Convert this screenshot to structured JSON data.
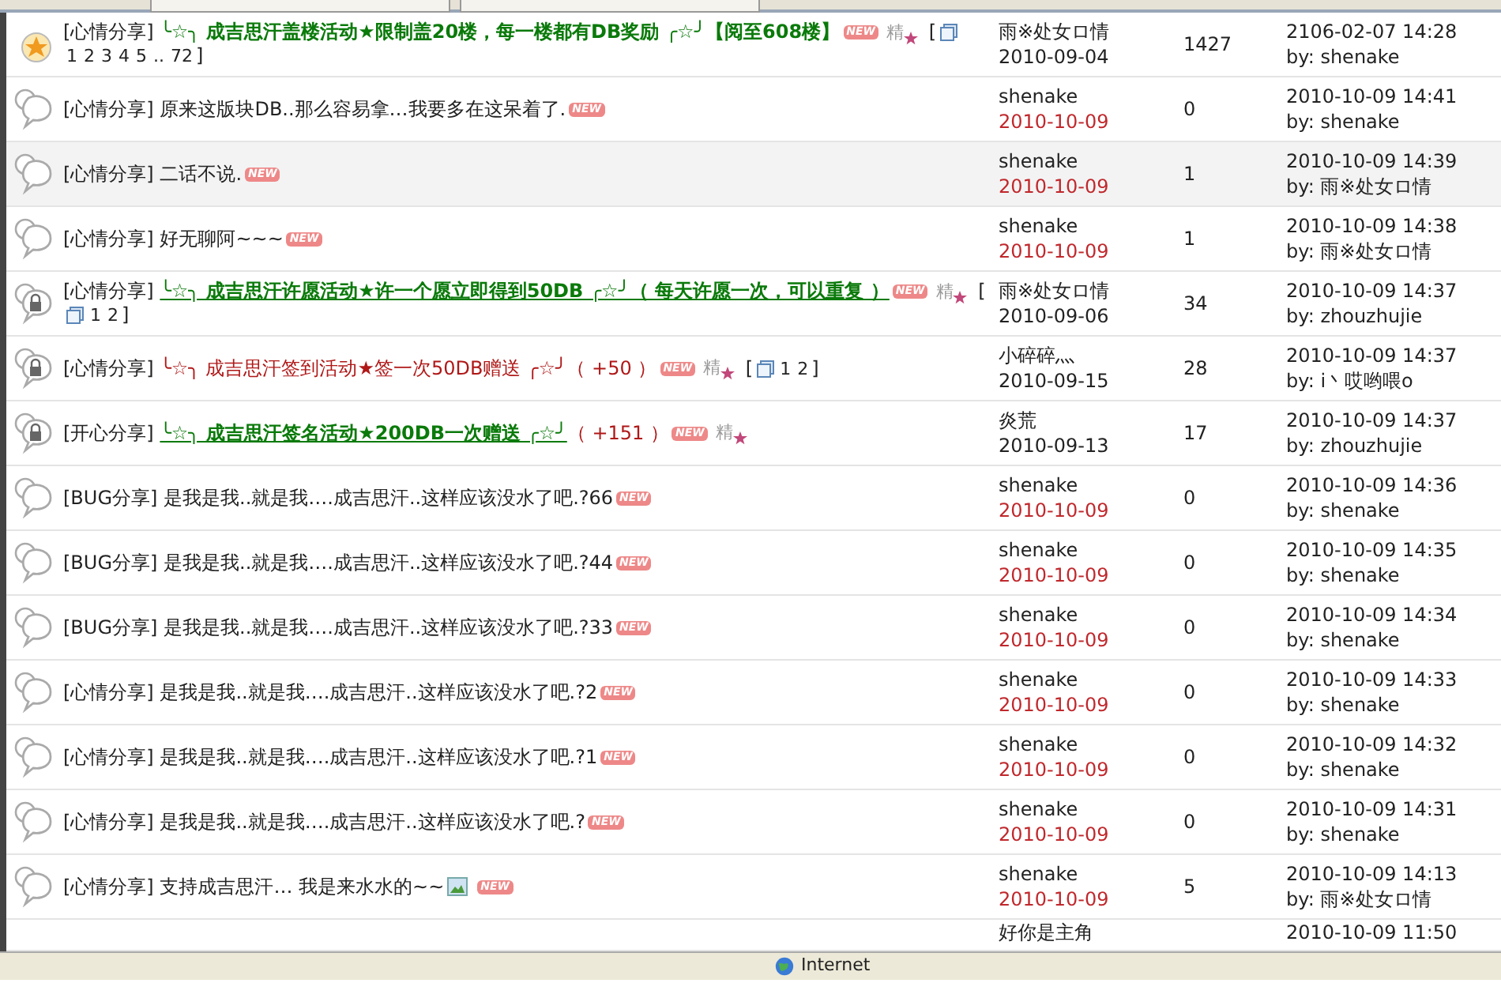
{
  "threads": [
    {
      "kind": "star",
      "selected": false,
      "category": "[心情分享]",
      "segments": [
        {
          "text": "╰☆╮ 成吉思汗盖楼活动★限制盖20楼，每一楼都有DB奖励 ╭☆╯",
          "kind": "green-bold"
        },
        {
          "text": "【阅至608楼】",
          "kind": "green-bold"
        }
      ],
      "badges": [
        {
          "kind": "new",
          "text": "NEW"
        },
        {
          "kind": "digest",
          "text": "精"
        }
      ],
      "pages": {
        "open": "[",
        "numbers": [
          "1",
          "2",
          "3",
          "4",
          "5",
          "..",
          "72"
        ],
        "close": "]"
      },
      "author": "雨※处女ロ情",
      "date": "2010-09-04",
      "recent": false,
      "replies": "1427",
      "last_time": "2106-02-07 14:28",
      "last_by": "by: shenake"
    },
    {
      "kind": "bubble",
      "selected": false,
      "category": "[心情分享]",
      "segments": [
        {
          "text": "原来这版块DB..那么容易拿…我要多在这呆着了.",
          "kind": "plain"
        }
      ],
      "badges": [
        {
          "kind": "new",
          "text": "NEW"
        }
      ],
      "author": "shenake",
      "date": "2010-10-09",
      "recent": true,
      "replies": "0",
      "last_time": "2010-10-09 14:41",
      "last_by": "by: shenake"
    },
    {
      "kind": "bubble",
      "selected": true,
      "category": "[心情分享]",
      "segments": [
        {
          "text": "二话不说.",
          "kind": "plain"
        }
      ],
      "badges": [
        {
          "kind": "new",
          "text": "NEW"
        }
      ],
      "author": "shenake",
      "date": "2010-10-09",
      "recent": true,
      "replies": "1",
      "last_time": "2010-10-09 14:39",
      "last_by": "by: 雨※处女ロ情"
    },
    {
      "kind": "bubble",
      "selected": false,
      "category": "[心情分享]",
      "segments": [
        {
          "text": "好无聊阿~~~",
          "kind": "plain"
        }
      ],
      "badges": [
        {
          "kind": "new",
          "text": "NEW"
        }
      ],
      "author": "shenake",
      "date": "2010-10-09",
      "recent": true,
      "replies": "1",
      "last_time": "2010-10-09 14:38",
      "last_by": "by: 雨※处女ロ情"
    },
    {
      "kind": "lock",
      "selected": false,
      "category": "[心情分享]",
      "segments": [
        {
          "text": "╰☆╮ 成吉思汗许愿活动★许一个愿立即得到50DB ╭☆╯（ 每天许愿一次，可以重复 ）",
          "kind": "green-link"
        }
      ],
      "badges": [
        {
          "kind": "new",
          "text": "NEW"
        },
        {
          "kind": "digest",
          "text": "精"
        }
      ],
      "pages": {
        "open": "[",
        "numbers": [
          "1",
          "2"
        ],
        "close": "]"
      },
      "author": "雨※处女ロ情",
      "date": "2010-09-06",
      "recent": false,
      "replies": "34",
      "last_time": "2010-10-09 14:37",
      "last_by": "by: zhouzhujie"
    },
    {
      "kind": "lock",
      "selected": false,
      "category": "[心情分享]",
      "segments": [
        {
          "text": "╰☆╮ 成吉思汗签到活动★签一次50DB赠送 ╭☆╯（ +50 ）",
          "kind": "red"
        }
      ],
      "badges": [
        {
          "kind": "new",
          "text": "NEW"
        },
        {
          "kind": "digest",
          "text": "精"
        }
      ],
      "pages": {
        "open": "[",
        "numbers": [
          "1",
          "2"
        ],
        "close": "]"
      },
      "author": "小碎碎灬",
      "date": "2010-09-15",
      "recent": false,
      "replies": "28",
      "last_time": "2010-10-09 14:37",
      "last_by": "by: i丶哎哟喂o"
    },
    {
      "kind": "lock",
      "selected": false,
      "category": "[开心分享]",
      "segments": [
        {
          "text": "╰☆╮ 成吉思汗签名活动★200DB一次赠送 ╭☆╯",
          "kind": "green-link"
        },
        {
          "text": "（ +151 ）",
          "kind": "red"
        }
      ],
      "badges": [
        {
          "kind": "new",
          "text": "NEW"
        },
        {
          "kind": "digest",
          "text": "精"
        }
      ],
      "author": "炎荒",
      "date": "2010-09-13",
      "recent": false,
      "replies": "17",
      "last_time": "2010-10-09 14:37",
      "last_by": "by: zhouzhujie"
    },
    {
      "kind": "bubble",
      "selected": false,
      "category": "[BUG分享]",
      "segments": [
        {
          "text": "是我是我..就是我….成吉思汗..这样应该没水了吧.?66",
          "kind": "plain"
        }
      ],
      "badges": [
        {
          "kind": "new",
          "text": "NEW"
        }
      ],
      "author": "shenake",
      "date": "2010-10-09",
      "recent": true,
      "replies": "0",
      "last_time": "2010-10-09 14:36",
      "last_by": "by: shenake"
    },
    {
      "kind": "bubble",
      "selected": false,
      "category": "[BUG分享]",
      "segments": [
        {
          "text": "是我是我..就是我….成吉思汗..这样应该没水了吧.?44",
          "kind": "plain"
        }
      ],
      "badges": [
        {
          "kind": "new",
          "text": "NEW"
        }
      ],
      "author": "shenake",
      "date": "2010-10-09",
      "recent": true,
      "replies": "0",
      "last_time": "2010-10-09 14:35",
      "last_by": "by: shenake"
    },
    {
      "kind": "bubble",
      "selected": false,
      "category": "[BUG分享]",
      "segments": [
        {
          "text": "是我是我..就是我….成吉思汗..这样应该没水了吧.?33",
          "kind": "plain"
        }
      ],
      "badges": [
        {
          "kind": "new",
          "text": "NEW"
        }
      ],
      "author": "shenake",
      "date": "2010-10-09",
      "recent": true,
      "replies": "0",
      "last_time": "2010-10-09 14:34",
      "last_by": "by: shenake"
    },
    {
      "kind": "bubble",
      "selected": false,
      "category": "[心情分享]",
      "segments": [
        {
          "text": "是我是我..就是我….成吉思汗..这样应该没水了吧.?2",
          "kind": "plain"
        }
      ],
      "badges": [
        {
          "kind": "new",
          "text": "NEW"
        }
      ],
      "author": "shenake",
      "date": "2010-10-09",
      "recent": true,
      "replies": "0",
      "last_time": "2010-10-09 14:33",
      "last_by": "by: shenake"
    },
    {
      "kind": "bubble",
      "selected": false,
      "category": "[心情分享]",
      "segments": [
        {
          "text": "是我是我..就是我….成吉思汗..这样应该没水了吧.?1",
          "kind": "plain"
        }
      ],
      "badges": [
        {
          "kind": "new",
          "text": "NEW"
        }
      ],
      "author": "shenake",
      "date": "2010-10-09",
      "recent": true,
      "replies": "0",
      "last_time": "2010-10-09 14:32",
      "last_by": "by: shenake"
    },
    {
      "kind": "bubble",
      "selected": false,
      "category": "[心情分享]",
      "segments": [
        {
          "text": "是我是我..就是我….成吉思汗..这样应该没水了吧.?",
          "kind": "plain"
        }
      ],
      "badges": [
        {
          "kind": "new",
          "text": "NEW"
        }
      ],
      "author": "shenake",
      "date": "2010-10-09",
      "recent": true,
      "replies": "0",
      "last_time": "2010-10-09 14:31",
      "last_by": "by: shenake"
    },
    {
      "kind": "bubble",
      "selected": false,
      "category": "[心情分享]",
      "segments": [
        {
          "text": "支持成吉思汗… 我是来水水的~~",
          "kind": "plain"
        }
      ],
      "badges": [
        {
          "kind": "image"
        },
        {
          "kind": "new",
          "text": "NEW"
        }
      ],
      "author": "shenake",
      "date": "2010-10-09",
      "recent": true,
      "replies": "5",
      "last_time": "2010-10-09 14:13",
      "last_by": "by: 雨※处女ロ情"
    }
  ],
  "partial_row": {
    "author": "好你是主角",
    "last_time": "2010-10-09 11:50"
  },
  "status_bar": {
    "zone": "Internet"
  }
}
